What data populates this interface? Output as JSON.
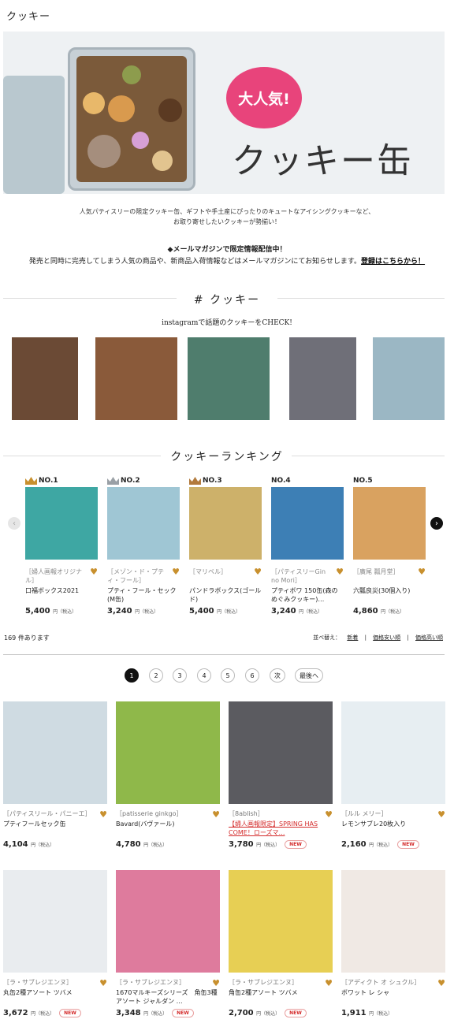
{
  "page_title": "クッキー",
  "hero": {
    "bubble": "大人気!",
    "heading": "クッキー缶"
  },
  "intro": {
    "line1": "人気パティスリーの限定クッキー缶、ギフトや手土産にぴったりのキュートなアイシングクッキーなど、",
    "line2": "お取り寄せしたいクッキーが勢揃い！"
  },
  "mail": {
    "title": "◆メールマガジンで限定情報配信中！",
    "text": "発売と同時に完売してしまう人気の商品や、新商品入荷情報などはメールマガジンにてお知らせします。",
    "link": "登録はこちらから！"
  },
  "instagram": {
    "title": "# クッキー",
    "subtitle": "instagramで話題のクッキーをCHECK!",
    "photos": [
      {
        "name": "instagram-photo-1",
        "bg": "#6b4a35"
      },
      {
        "name": "instagram-photo-2",
        "bg": "#8a5a3a"
      },
      {
        "name": "instagram-photo-3",
        "bg": "#4f7d6d"
      },
      {
        "name": "instagram-photo-4",
        "bg": "#6f6f78"
      },
      {
        "name": "instagram-photo-5",
        "bg": "#9bb7c4"
      }
    ]
  },
  "ranking": {
    "title": "クッキーランキング",
    "items": [
      {
        "no": "NO.1",
        "crown": "#c8902e",
        "brand": "［婦人画報オリジナル］",
        "name": "口福ボックス2021",
        "price": "5,400",
        "tax": "円（税込）",
        "img": "#3ea7a3"
      },
      {
        "no": "NO.2",
        "crown": "#9aa0a6",
        "brand": "［メゾン・ド・プティ・フール］",
        "name": "プティ・フール・セック(M缶)",
        "price": "3,240",
        "tax": "円（税込）",
        "img": "#9fc6d4"
      },
      {
        "no": "NO.3",
        "crown": "#b27a3d",
        "brand": "［マリベル］",
        "name": "パンドラボックス(ゴールド)",
        "price": "5,400",
        "tax": "円（税込）",
        "img": "#cdb16a"
      },
      {
        "no": "NO.4",
        "crown": "",
        "brand": "［パティスリーGin no Mori］",
        "name": "プティボワ 150缶(森のめぐみクッキー)…",
        "price": "3,240",
        "tax": "円（税込）",
        "img": "#3d7fb5"
      },
      {
        "no": "NO.5",
        "crown": "",
        "brand": "［廣尾 瓢月堂］",
        "name": "六瓢良災(30個入り)",
        "price": "4,860",
        "tax": "円（税込）",
        "img": "#d9a260"
      }
    ]
  },
  "listing": {
    "count": "169 件あります",
    "sort_label": "並べ替え：",
    "sort_options": [
      "新着",
      "価格安い順",
      "価格高い順"
    ],
    "pages": [
      "1",
      "2",
      "3",
      "4",
      "5",
      "6"
    ],
    "next": "次",
    "last": "最後へ"
  },
  "products": [
    {
      "brand": "［パティスリール・パニーエ］",
      "name": "プティフールセック缶",
      "price": "4,104",
      "tax": "円（税込）",
      "new": "",
      "img": "#cfdbe2"
    },
    {
      "brand": "［patisserie ginkgo］",
      "name": "Bavard(バヴァール)",
      "price": "4,780",
      "tax": "円（税込）",
      "new": "",
      "img": "#8fb84a"
    },
    {
      "brand": "［8ablish］",
      "name": "【婦人画報限定】SPRING HAS COME！ローズマ…",
      "price": "3,780",
      "tax": "円（税込）",
      "new": "NEW",
      "red": true,
      "img": "#5b5b60"
    },
    {
      "brand": "［ルル メリー］",
      "name": "レモンサブレ20枚入り",
      "price": "2,160",
      "tax": "円（税込）",
      "new": "NEW",
      "img": "#e7eef2"
    },
    {
      "brand": "［ラ・サブレジエンヌ］",
      "name": "丸缶2種アソート ツバメ",
      "price": "3,672",
      "tax": "円（税込）",
      "new": "NEW",
      "img": "#e9ecef"
    },
    {
      "brand": "［ラ・サブレジエンヌ］",
      "name": "1670マルキーズシリーズ　角缶3種アソート ジャルダン …",
      "price": "3,348",
      "tax": "円（税込）",
      "new": "NEW",
      "img": "#de7b9d"
    },
    {
      "brand": "［ラ・サブレジエンヌ］",
      "name": "角缶2種アソート ツバメ",
      "price": "2,700",
      "tax": "円（税込）",
      "new": "NEW",
      "img": "#e7cf54"
    },
    {
      "brand": "［アディクト オ シュクル］",
      "name": "ボワット レ シャ",
      "price": "1,911",
      "tax": "円（税込）",
      "new": "",
      "img": "#f0e9e4"
    }
  ],
  "colors": {
    "accent": "#c8902e",
    "new": "#d42b2b",
    "bubble": "#e8447b"
  }
}
